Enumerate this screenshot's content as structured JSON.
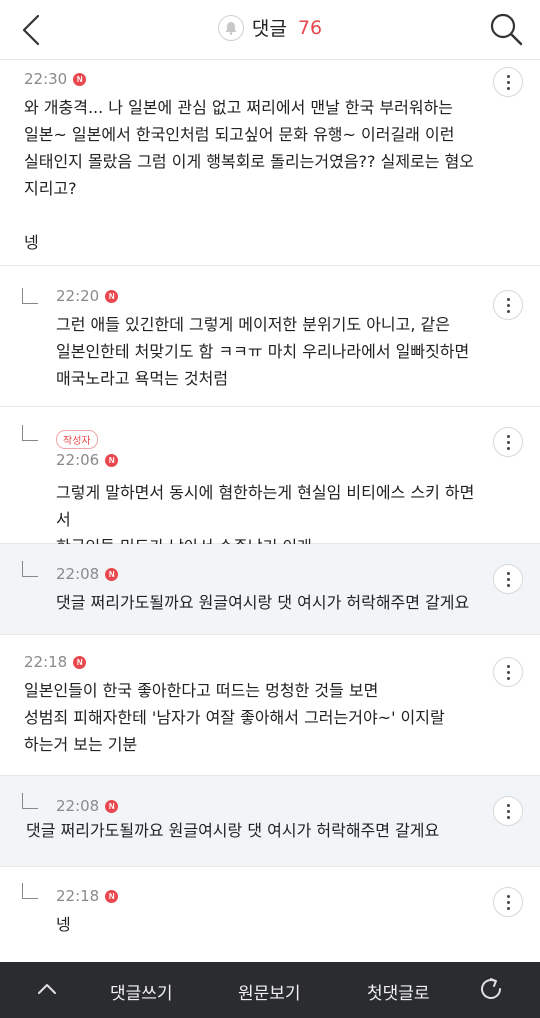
{
  "header": {
    "title": "댓글",
    "count": "76"
  },
  "comments": [
    {
      "time": "22:30",
      "badge": "N",
      "text": "와 개충격... 나 일본에 관심 없고 쩌리에서 맨날 한국 부러워하는\n일본~ 일본에서 한국인처럼 되고싶어 문화 유행~ 이러길래 이런\n실태인지 몰랐음 그럼 이게 행복회로 돌리는거였음?? 실제로는 혐오\n지리고?\n\n넹"
    },
    {
      "time": "22:20",
      "badge": "N",
      "text": "그런 애들 있긴한데 그렇게 메이저한 분위기도 아니고, 같은\n일본인한테 처맞기도 함 ㅋㅋㅠ 마치 우리나라에서 일빠짓하면\n매국노라고 욕먹는 것처럼"
    },
    {
      "author_badge": "작성자",
      "time": "22:06",
      "badge": "N",
      "text": "그렇게 말하면서 동시에 혐한하는게 현실임 비티에스 스키 하면서\n한국인들 민도가 낮아서 수준낮기 이래"
    },
    {
      "time": "22:08",
      "badge": "N",
      "text": "댓글 쩌리가도될까요 원글여시랑 댓 여시가 허락해주면 갈게요"
    },
    {
      "time": "22:18",
      "badge": "N",
      "text": "일본인들이 한국 좋아한다고 떠드는 멍청한 것들 보면\n성범죄 피해자한테 '남자가 여잘 좋아해서 그러는거야~' 이지랄\n하는거 보는 기분"
    },
    {
      "time": "22:08",
      "badge": "N",
      "text": "댓글 쩌리가도될까요 원글여시랑 댓 여시가 허락해주면 갈게요"
    },
    {
      "time": "22:18",
      "badge": "N",
      "text": "넹"
    }
  ],
  "bottom_bar": {
    "write_comment": "댓글쓰기",
    "view_original": "원문보기",
    "first_comment": "첫댓글로"
  },
  "colors": {
    "accent": "#e8484d",
    "bottom_bar": "#2b2c30",
    "shaded_row": "#f2f5f8"
  }
}
